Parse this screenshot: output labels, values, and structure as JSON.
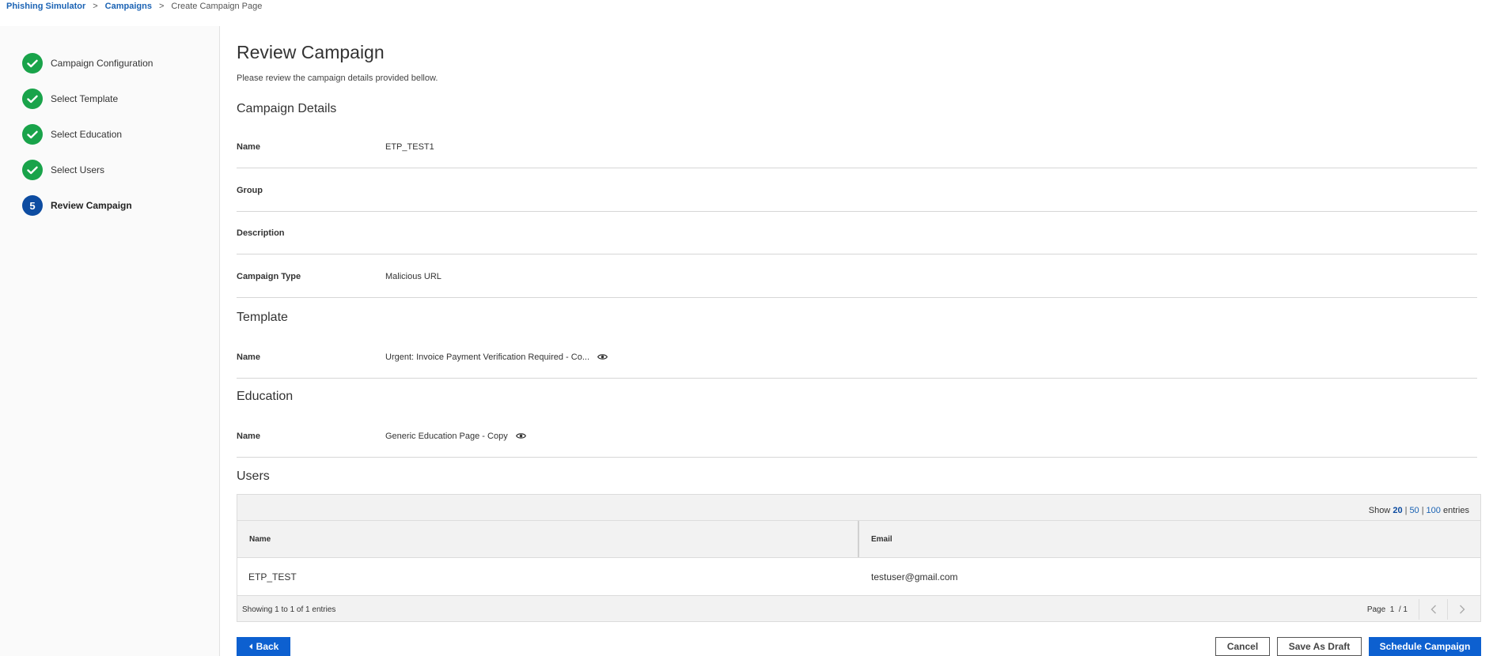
{
  "breadcrumb": {
    "items": [
      "Phishing Simulator",
      "Campaigns",
      "Create Campaign Page"
    ],
    "separator": ">"
  },
  "steps": [
    {
      "label": "Campaign Configuration",
      "status": "done",
      "icon": "check-icon"
    },
    {
      "label": "Select Template",
      "status": "done",
      "icon": "check-icon"
    },
    {
      "label": "Select Education",
      "status": "done",
      "icon": "check-icon"
    },
    {
      "label": "Select Users",
      "status": "done",
      "icon": "check-icon"
    },
    {
      "label": "Review Campaign",
      "status": "current",
      "number": "5"
    }
  ],
  "review": {
    "title": "Review Campaign",
    "subtitle": "Please review the campaign details provided bellow."
  },
  "campaign_details": {
    "title": "Campaign Details",
    "rows": [
      {
        "label": "Name",
        "value": "ETP_TEST1"
      },
      {
        "label": "Group",
        "value": ""
      },
      {
        "label": "Description",
        "value": ""
      },
      {
        "label": "Campaign Type",
        "value": "Malicious URL"
      }
    ]
  },
  "template": {
    "title": "Template",
    "name_label": "Name",
    "name_value": "Urgent: Invoice Payment Verification Required - Co...",
    "icon": "eye-icon"
  },
  "education": {
    "title": "Education",
    "name_label": "Name",
    "name_value": "Generic Education Page - Copy",
    "icon": "eye-icon"
  },
  "users": {
    "title": "Users",
    "show_label": "Show",
    "entries_label": "entries",
    "page_sizes": [
      "20",
      "50",
      "100"
    ],
    "selected_page_size": "20",
    "columns": [
      "Name",
      "Email"
    ],
    "rows": [
      {
        "name": "ETP_TEST",
        "email": "testuser@gmail.com"
      }
    ],
    "showing_text": "Showing 1 to 1 of 1 entries",
    "page_label": "Page",
    "page_current": "1",
    "page_total": "/ 1"
  },
  "buttons": {
    "back": "Back",
    "cancel": "Cancel",
    "save_draft": "Save As Draft",
    "schedule": "Schedule Campaign"
  },
  "colors": {
    "accent": "#0d60d0",
    "done": "#19a34a",
    "current_step": "#0d4ca1",
    "link": "#1b63b4"
  }
}
